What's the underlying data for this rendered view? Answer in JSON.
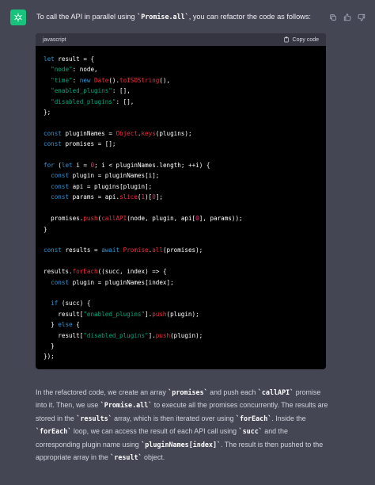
{
  "assistant": {
    "avatar": "openai-logo-icon"
  },
  "message": {
    "intro": {
      "before": "To call the API in parallel using ",
      "code": "`Promise.all`",
      "after": ", you can refactor the code as follows:"
    },
    "actions": [
      "copy-icon",
      "thumbs-up-icon",
      "thumbs-down-icon"
    ]
  },
  "code_block": {
    "language": "javascript",
    "copy_label": "Copy code",
    "lines": [
      "let result = {",
      "  \"node\": node,",
      "  \"time\": new Date().toISOString(),",
      "  \"enabled_plugins\": [],",
      "  \"disabled_plugins\": [],",
      "};",
      "",
      "const pluginNames = Object.keys(plugins);",
      "const promises = [];",
      "",
      "for (let i = 0; i < pluginNames.length; ++i) {",
      "  const plugin = pluginNames[i];",
      "  const api = plugins[plugin];",
      "  const params = api.slice(1)[0];",
      "",
      "  promises.push(callAPI(node, plugin, api[0], params));",
      "}",
      "",
      "const results = await Promise.all(promises);",
      "",
      "results.forEach((succ, index) => {",
      "  const plugin = pluginNames[index];",
      "",
      "  if (succ) {",
      "    result[\"enabled_plugins\"].push(plugin);",
      "  } else {",
      "    result[\"disabled_plugins\"].push(plugin);",
      "  }",
      "});"
    ]
  },
  "explanation": [
    {
      "t": "In the refactored code, we create an array "
    },
    {
      "c": "`promises`"
    },
    {
      "t": " and push each "
    },
    {
      "c": "`callAPI`"
    },
    {
      "t": " promise into it. Then, we use "
    },
    {
      "c": "`Promise.all`"
    },
    {
      "t": " to execute all the promises concurrently. The results are stored in the "
    },
    {
      "c": "`results`"
    },
    {
      "t": " array, which is then iterated over using "
    },
    {
      "c": "`forEach`"
    },
    {
      "t": ". Inside the "
    },
    {
      "c": "`forEach`"
    },
    {
      "t": " loop, we can access the result of each API call using "
    },
    {
      "c": "`succ`"
    },
    {
      "t": " and the corresponding plugin name using "
    },
    {
      "c": "`pluginNames[index]`"
    },
    {
      "t": ". The result is then pushed to the appropriate array in the "
    },
    {
      "c": "`result`"
    },
    {
      "t": " object."
    }
  ]
}
